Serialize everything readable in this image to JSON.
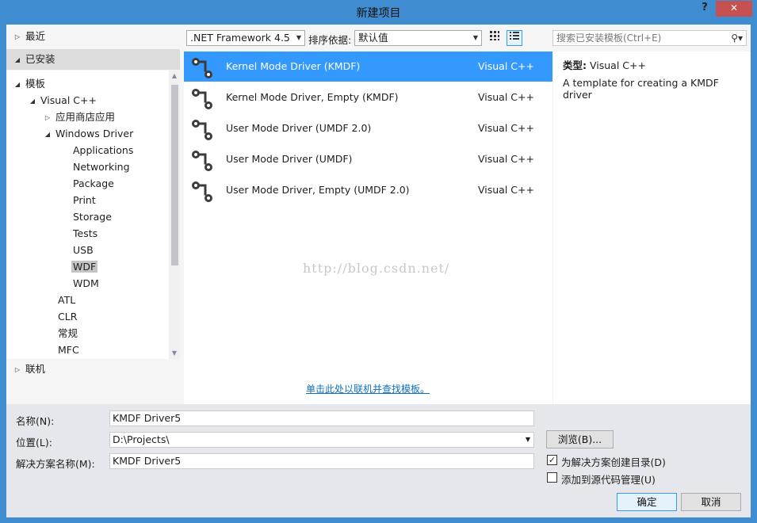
{
  "window": {
    "title": "新建项目",
    "help": "?",
    "close": "✕"
  },
  "tree": {
    "recent": "最近",
    "installed": "已安装",
    "templates": "模板",
    "visual_cpp": "Visual C++",
    "store_apps": "应用商店应用",
    "windows_driver": "Windows Driver",
    "children": [
      "Applications",
      "Networking",
      "Package",
      "Print",
      "Storage",
      "Tests",
      "USB",
      "WDF",
      "WDM"
    ],
    "atl": "ATL",
    "clr": "CLR",
    "general": "常规",
    "mfc": "MFC",
    "online": "联机"
  },
  "toolbar": {
    "framework": ".NET Framework 4.5",
    "sort_label": "排序依据:",
    "sort_value": "默认值",
    "search_placeholder": "搜索已安装模板(Ctrl+E)"
  },
  "templates": [
    {
      "name": "Kernel Mode Driver (KMDF)",
      "lang": "Visual C++"
    },
    {
      "name": "Kernel Mode Driver, Empty (KMDF)",
      "lang": "Visual C++"
    },
    {
      "name": "User Mode Driver (UMDF 2.0)",
      "lang": "Visual C++"
    },
    {
      "name": "User Mode Driver (UMDF)",
      "lang": "Visual C++"
    },
    {
      "name": "User Mode Driver, Empty (UMDF 2.0)",
      "lang": "Visual C++"
    }
  ],
  "online_link": "单击此处以联机并查找模板。",
  "watermark": "http://blog.csdn.net/",
  "description": {
    "type_label": "类型:",
    "type_value": "Visual C++",
    "text": "A template for creating a KMDF driver"
  },
  "form": {
    "name_label": "名称(N):",
    "name_value": "KMDF Driver5",
    "location_label": "位置(L):",
    "location_value": "D:\\Projects\\",
    "solution_label": "解决方案名称(M):",
    "solution_value": "KMDF Driver5",
    "browse": "浏览(B)...",
    "create_dir_label": "为解决方案创建目录(D)",
    "create_dir_checked": true,
    "source_control_label": "添加到源代码管理(U)",
    "source_control_checked": false,
    "ok": "确定",
    "cancel": "取消"
  },
  "colors": {
    "titlebar": "#3f8dd0",
    "selection": "#3399ff",
    "close": "#c75050"
  }
}
